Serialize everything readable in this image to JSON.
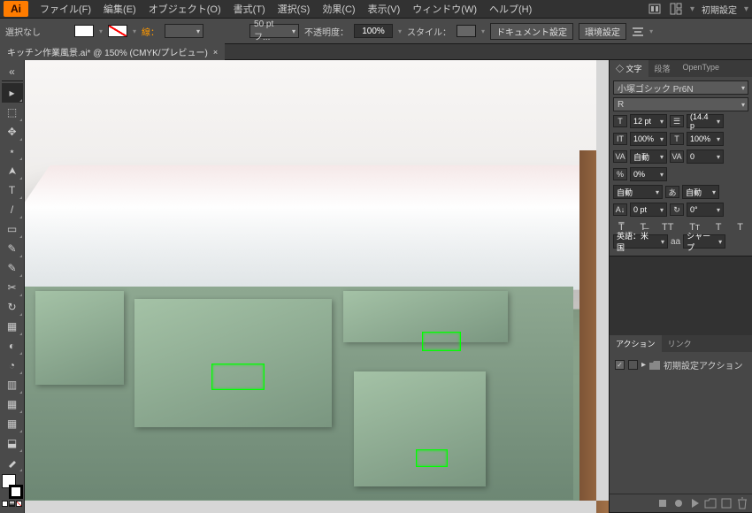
{
  "app": {
    "logo": "Ai",
    "init_text": "初期設定"
  },
  "menu": [
    "ファイル(F)",
    "編集(E)",
    "オブジェクト(O)",
    "書式(T)",
    "選択(S)",
    "効果(C)",
    "表示(V)",
    "ウィンドウ(W)",
    "ヘルプ(H)"
  ],
  "control": {
    "no_selection": "選択なし",
    "stroke_label": "線：",
    "stroke_width": "",
    "brush_def": "50 pt フ...",
    "opacity_label": "不透明度：",
    "opacity_value": "100%",
    "style_label": "スタイル：",
    "doc_setup": "ドキュメント設定",
    "prefs": "環境設定"
  },
  "doc_tab": {
    "name": "キッチン作業風景.ai* @ 150% (CMYK/プレビュー)"
  },
  "tools": [
    "▸",
    "⬚",
    "✥",
    "⋆",
    "T",
    "/",
    "▭",
    "✎",
    "✂",
    "↻",
    "▦",
    "◐",
    "◔",
    "▥",
    "⬓",
    "✋",
    "🔍",
    "⎀"
  ],
  "char_panel": {
    "tabs": [
      "◇ 文字",
      "段落",
      "OpenType"
    ],
    "font_family": "小塚ゴシック Pr6N",
    "font_style": "R",
    "size": "12 pt",
    "leading": "(14.4 p",
    "hscale": "100%",
    "vscale": "100%",
    "kerning": "自動",
    "tracking": "0",
    "baseline": "0%",
    "tsume": "自動",
    "aki_before": "自動",
    "char_rotation": "0 pt",
    "rotation": "0°",
    "lang": "英語：米国",
    "antialias_label": "aa",
    "antialias": "シャープ"
  },
  "actions_panel": {
    "tabs": [
      "アクション",
      "リンク"
    ],
    "default_action": "初期設定アクション"
  }
}
